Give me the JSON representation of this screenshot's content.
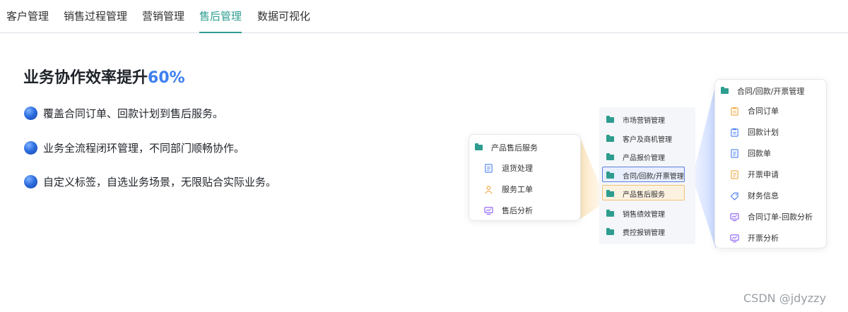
{
  "tabs": [
    {
      "label": "客户管理",
      "active": false
    },
    {
      "label": "销售过程管理",
      "active": false
    },
    {
      "label": "营销管理",
      "active": false
    },
    {
      "label": "售后管理",
      "active": true
    },
    {
      "label": "数据可视化",
      "active": false
    }
  ],
  "headline": {
    "prefix": "业务协作效率提升",
    "highlight": "60%"
  },
  "bullets": [
    "覆盖合同订单、回款计划到售后服务。",
    "业务全流程闭环管理，不同部门顺畅协作。",
    "自定义标签，自选业务场景，无限贴合实际业务。"
  ],
  "left_card": {
    "title": "产品售后服务",
    "items": [
      {
        "label": "退货处理",
        "icon": "document-icon"
      },
      {
        "label": "服务工单",
        "icon": "person-icon"
      },
      {
        "label": "售后分析",
        "icon": "monitor-chart-icon"
      }
    ]
  },
  "middle_list": {
    "items": [
      {
        "label": "市场营销管理",
        "state": "normal"
      },
      {
        "label": "客户及商机管理",
        "state": "normal"
      },
      {
        "label": "产品报价管理",
        "state": "normal"
      },
      {
        "label": "合同/回款/开票管理",
        "state": "selected-blue"
      },
      {
        "label": "产品售后服务",
        "state": "selected-orange"
      },
      {
        "label": "销售绩效管理",
        "state": "normal"
      },
      {
        "label": "费控报销管理",
        "state": "normal"
      }
    ]
  },
  "right_card": {
    "title": "合同/回款/开票管理",
    "items": [
      {
        "label": "合同订单",
        "icon": "orange-clipboard-icon"
      },
      {
        "label": "回款计划",
        "icon": "blue-clipboard-icon"
      },
      {
        "label": "回款单",
        "icon": "blue-document-icon"
      },
      {
        "label": "开票申请",
        "icon": "orange-document-icon"
      },
      {
        "label": "财务信息",
        "icon": "tag-icon"
      },
      {
        "label": "合同订单-回款分析",
        "icon": "monitor-chart-icon"
      },
      {
        "label": "开票分析",
        "icon": "monitor-chart-icon"
      }
    ]
  },
  "watermark": "CSDN @jdyzzy",
  "colors": {
    "accent": "#2e9d8f",
    "highlight": "#3d7ff0",
    "orange": "#f0a640",
    "purple": "#8a5cf5"
  }
}
